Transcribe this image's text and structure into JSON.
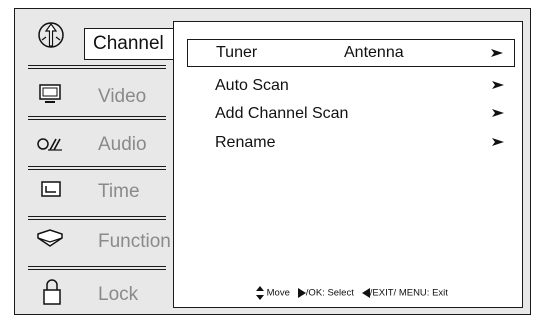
{
  "sidebar": {
    "items": [
      {
        "label": "Channel",
        "icon": "antenna-icon",
        "active": true
      },
      {
        "label": "Video",
        "icon": "monitor-icon",
        "active": false
      },
      {
        "label": "Audio",
        "icon": "audio-icon",
        "active": false
      },
      {
        "label": "Time",
        "icon": "time-icon",
        "active": false
      },
      {
        "label": "Function",
        "icon": "function-icon",
        "active": false
      },
      {
        "label": "Lock",
        "icon": "lock-icon",
        "active": false
      }
    ]
  },
  "menu": {
    "items": [
      {
        "label": "Tuner",
        "value": "Antenna",
        "selected": true
      },
      {
        "label": "Auto Scan",
        "value": "",
        "selected": false
      },
      {
        "label": "Add Channel Scan",
        "value": "",
        "selected": false
      },
      {
        "label": "Rename",
        "value": "",
        "selected": false
      }
    ]
  },
  "help": {
    "move": "Move",
    "select": "/OK: Select",
    "exit": "/EXIT/ MENU: Exit"
  }
}
